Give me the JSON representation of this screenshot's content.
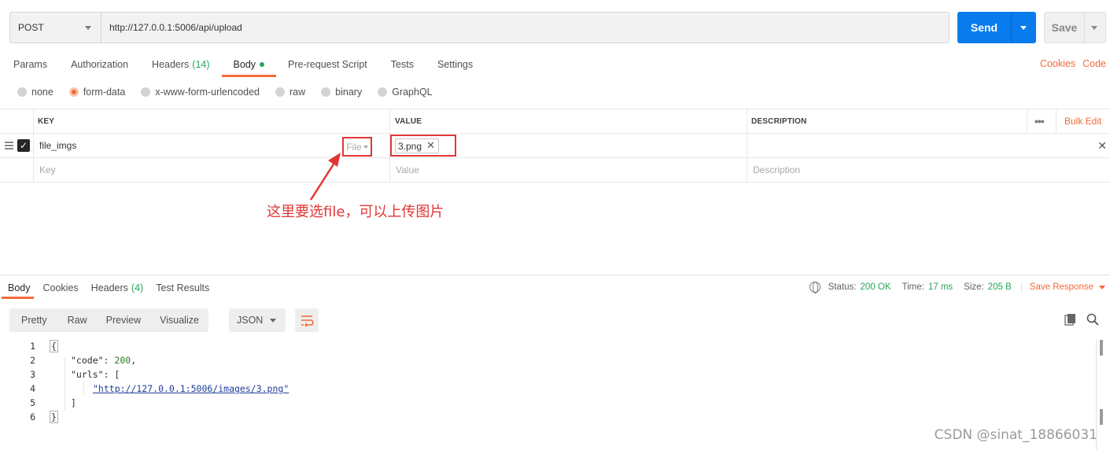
{
  "request": {
    "method": "POST",
    "url": "http://127.0.0.1:5006/api/upload",
    "send_label": "Send",
    "save_label": "Save"
  },
  "request_tabs": [
    {
      "label": "Params"
    },
    {
      "label": "Authorization"
    },
    {
      "label": "Headers",
      "count": "(14)"
    },
    {
      "label": "Body",
      "active": true
    },
    {
      "label": "Pre-request Script"
    },
    {
      "label": "Tests"
    },
    {
      "label": "Settings"
    }
  ],
  "right_links": {
    "cookies": "Cookies",
    "code": "Code"
  },
  "body_types": [
    {
      "label": "none"
    },
    {
      "label": "form-data",
      "checked": true
    },
    {
      "label": "x-www-form-urlencoded"
    },
    {
      "label": "raw"
    },
    {
      "label": "binary"
    },
    {
      "label": "GraphQL"
    }
  ],
  "table": {
    "headers": {
      "key": "KEY",
      "value": "VALUE",
      "description": "DESCRIPTION",
      "bulk_edit": "Bulk Edit"
    },
    "rows": [
      {
        "key": "file_imgs",
        "type": "File",
        "value": "3.png",
        "description": ""
      }
    ],
    "placeholders": {
      "key": "Key",
      "value": "Value",
      "description": "Description"
    }
  },
  "annotation": "这里要选file，可以上传图片",
  "response_tabs": [
    {
      "label": "Body",
      "active": true
    },
    {
      "label": "Cookies"
    },
    {
      "label": "Headers",
      "count": "(4)"
    },
    {
      "label": "Test Results"
    }
  ],
  "status": {
    "status_label": "Status:",
    "status_value": "200 OK",
    "time_label": "Time:",
    "time_value": "17 ms",
    "size_label": "Size:",
    "size_value": "205 B",
    "save_response": "Save Response"
  },
  "view_modes": [
    "Pretty",
    "Raw",
    "Preview",
    "Visualize"
  ],
  "format": "JSON",
  "code_lines": [
    {
      "n": "1",
      "text": "{"
    },
    {
      "n": "2",
      "key": "\"code\"",
      "value": "200"
    },
    {
      "n": "3",
      "key": "\"urls\"",
      "value": "["
    },
    {
      "n": "4",
      "text": "\"http://127.0.0.1:5006/images/3.png\""
    },
    {
      "n": "5",
      "text": "]"
    },
    {
      "n": "6",
      "text": "}"
    }
  ],
  "watermark": "CSDN @sinat_18866031",
  "colors": {
    "accent": "#f26b3a",
    "send": "#097bed",
    "success": "#26a55a",
    "annotation": "#e23535"
  }
}
